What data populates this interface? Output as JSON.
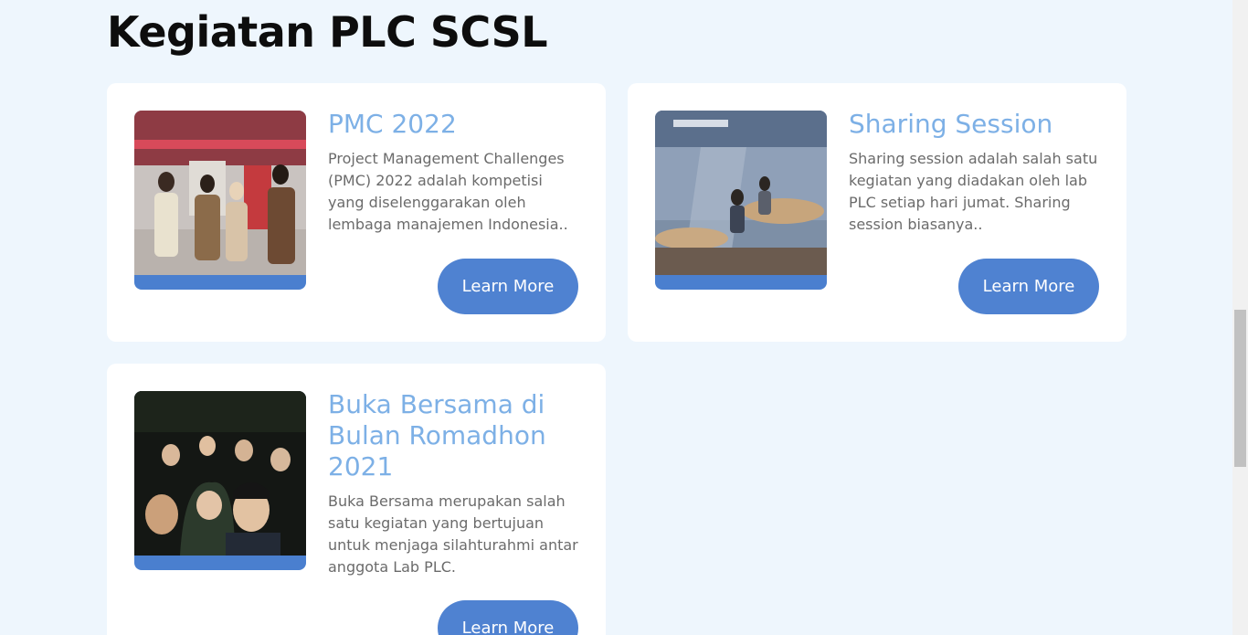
{
  "section": {
    "title": "Kegiatan PLC SCSL"
  },
  "cards": [
    {
      "title": "PMC 2022",
      "description": "Project Management Challenges (PMC) 2022 adalah kompetisi yang diselenggarakan oleh lembaga manajemen Indonesia..",
      "button_label": "Learn More"
    },
    {
      "title": "Sharing Session",
      "description": "Sharing session adalah salah satu kegiatan yang diadakan oleh lab PLC setiap hari jumat. Sharing session biasanya..",
      "button_label": "Learn More"
    },
    {
      "title": "Buka Bersama di Bulan Romadhon 2021",
      "description": "Buka Bersama merupakan salah satu kegiatan yang bertujuan untuk menjaga silahturahmi antar anggota Lab PLC.",
      "button_label": "Learn More"
    }
  ],
  "colors": {
    "page_background": "#eef6fd",
    "card_title": "#7db0e6",
    "button": "#4f82d1",
    "image_footer": "#4a7fcf"
  }
}
